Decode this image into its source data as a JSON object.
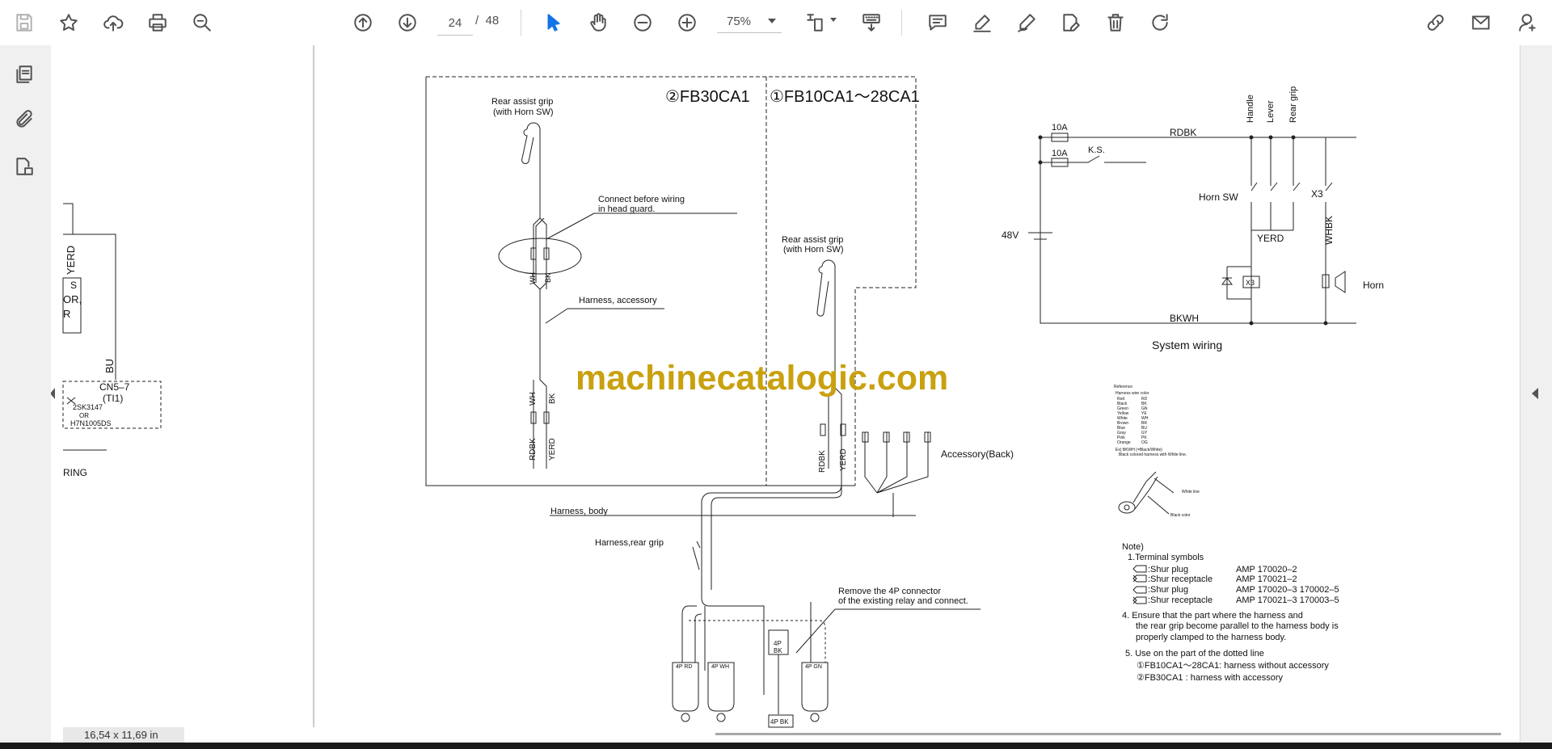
{
  "toolbar": {
    "page_current": "24",
    "page_separator": "/",
    "page_total": "48",
    "zoom": "75%"
  },
  "status": {
    "page_size": "16,54 x 11,69 in"
  },
  "watermark": "machinecatalogic.com",
  "diagram": {
    "left_fragment": {
      "wire_yerd": "YERD",
      "label_s": "S",
      "label_or": "OR,",
      "label_r": "R",
      "wire_bu": "BU",
      "connector": "CN5–7",
      "connector_sub": "(TI1)",
      "part1": "2SK3147",
      "part_or": "OR",
      "part2": "H7N1005DS",
      "title_fragment": "RING"
    },
    "variant_2": "②FB30CA1",
    "variant_1": "①FB10CA1～28CA1",
    "rear_grip_label_1": "Rear assist grip",
    "rear_grip_label_2": "(with Horn SW)",
    "connect_note_1": "Connect before wiring",
    "connect_note_2": "in head guard.",
    "harness_accessory": "Harness, accessory",
    "harness_body": "Harness, body",
    "harness_rear_grip": "Harness,rear grip",
    "accessory_back": "Accessory(Back)",
    "remove_note_1": "Remove the 4P connector",
    "remove_note_2": "of the existing relay and connect.",
    "wire_wh": "WH",
    "wire_bk": "BK",
    "wire_rdbk": "RDBK",
    "wire_yerd": "YERD",
    "conn_4p_rd": "4P RD",
    "conn_4p_wh": "4P WH",
    "conn_4p_gn": "4P GN",
    "conn_4p": "4P",
    "conn_bk": "BK",
    "conn_4p_bk": "4P BK"
  },
  "system_wiring": {
    "title": "System wiring",
    "fuse1": "10A",
    "fuse2": "10A",
    "wire_top": "RDBK",
    "ks": "K.S.",
    "handle": "Handle",
    "lever": "Lever",
    "rear_grip": "Rear grip",
    "horn_sw": "Horn SW",
    "x3": "X3",
    "battery": "48V",
    "yerd": "YERD",
    "whbk": "WHBK",
    "relay": "X3",
    "horn": "Horn",
    "wire_bottom": "BKWH"
  },
  "reference": {
    "title": "Reference",
    "header": "Harness wire color",
    "colors": [
      "Red",
      "Black",
      "Green",
      "Yellow",
      "White",
      "Brown",
      "Blue",
      "Gray",
      "Pink",
      "Orange"
    ],
    "codes": [
      "RD",
      "BK",
      "GN",
      "YE",
      "WH",
      "BR",
      "BU",
      "GY",
      "PK",
      "OG"
    ],
    "example_1": "Ex) BKWH (=Black/White)",
    "example_2": "Black colored harness with White line.",
    "white_line": "White line",
    "black_color": "Black color"
  },
  "notes": {
    "title": "Note)",
    "item1": "1.Terminal symbols",
    "sym1": ":Shur plug",
    "amp1": "AMP 170020–2",
    "sym2": ":Shur receptacle",
    "amp2": "AMP 170021–2",
    "sym3": ":Shur plug",
    "amp3": "AMP 170020–3 170002–5",
    "sym4": ":Shur receptacle",
    "amp4": "AMP 170021–3 170003–5",
    "item4_1": "4. Ensure that the part where the harness and",
    "item4_2": "the rear grip become parallel to the harness body is",
    "item4_3": "properly clamped to the harness body.",
    "item5": "5. Use on the part of the dotted line",
    "item5_a": "①FB10CA1～28CA1: harness without accessory",
    "item5_b": "②FB30CA1 : harness with accessory"
  }
}
